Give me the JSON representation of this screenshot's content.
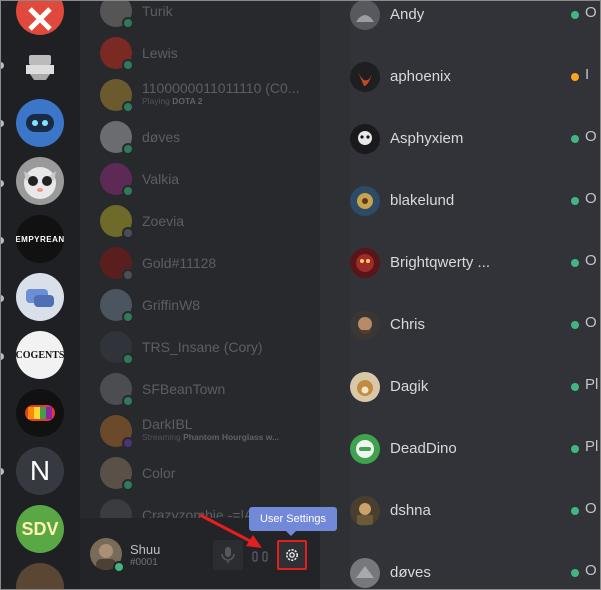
{
  "friends": [
    {
      "name": "Turik",
      "status": "online"
    },
    {
      "name": "Lewis",
      "status": "online"
    },
    {
      "name": "1100000011011110 (C0...",
      "activity_prefix": "Playing",
      "activity": "DOTA 2",
      "status": "online"
    },
    {
      "name": "døves",
      "status": "online"
    },
    {
      "name": "Valkia",
      "status": "online"
    },
    {
      "name": "Zoevia",
      "status": "offline"
    },
    {
      "name": "Gold#11128",
      "status": "offline"
    },
    {
      "name": "GriffinW8",
      "status": "online"
    },
    {
      "name": "TRS_Insane (Cory)",
      "status": "online"
    },
    {
      "name": "SFBeanTown",
      "status": "online"
    },
    {
      "name": "DarkIBL",
      "activity_prefix": "Streaming",
      "activity": "Phantom Hourglass w...",
      "status": "streaming"
    },
    {
      "name": "Color",
      "status": "online"
    },
    {
      "name": "Crazyzombie -=|A",
      "status": "online"
    }
  ],
  "user_panel": {
    "username": "Shuu",
    "discriminator": "#0001",
    "tooltip": "User Settings"
  },
  "members": [
    {
      "name": "Andy",
      "status": "online",
      "status_text": "O"
    },
    {
      "name": "aphoenix",
      "status": "idle",
      "status_text": "I"
    },
    {
      "name": "Asphyxiem",
      "status": "online",
      "status_text": "O"
    },
    {
      "name": "blakelund",
      "status": "online",
      "status_text": "O"
    },
    {
      "name": "Brightqwerty ...",
      "status": "online",
      "status_text": "O"
    },
    {
      "name": "Chris",
      "status": "online",
      "status_text": "O"
    },
    {
      "name": "Dagik",
      "status": "online",
      "status_text": "Pl"
    },
    {
      "name": "DeadDino",
      "status": "online",
      "status_text": "Pl"
    },
    {
      "name": "dshna",
      "status": "online",
      "status_text": "O"
    },
    {
      "name": "døves",
      "status": "online",
      "status_text": "O"
    }
  ],
  "servers": [
    {
      "icon": "crossed-tools-icon"
    },
    {
      "icon": "badge-logo-icon"
    },
    {
      "icon": "robot-icon"
    },
    {
      "icon": "cat-face-icon"
    },
    {
      "text": "EMPYREAN",
      "icon": "empyrean-logo-icon"
    },
    {
      "icon": "chat-bubbles-icon"
    },
    {
      "text": "COGENTS",
      "icon": "cogents-logo-icon"
    },
    {
      "icon": "rainbow-gamepad-icon"
    },
    {
      "text": "N",
      "icon": "letter-n-icon"
    },
    {
      "text": "SDV",
      "icon": "sdv-logo-icon"
    }
  ],
  "colors": {
    "online": "#43b581",
    "idle": "#faa61a",
    "offline": "#747f8d",
    "streaming": "#593695",
    "tooltip": "#7289da",
    "highlight": "#e51e1e"
  }
}
